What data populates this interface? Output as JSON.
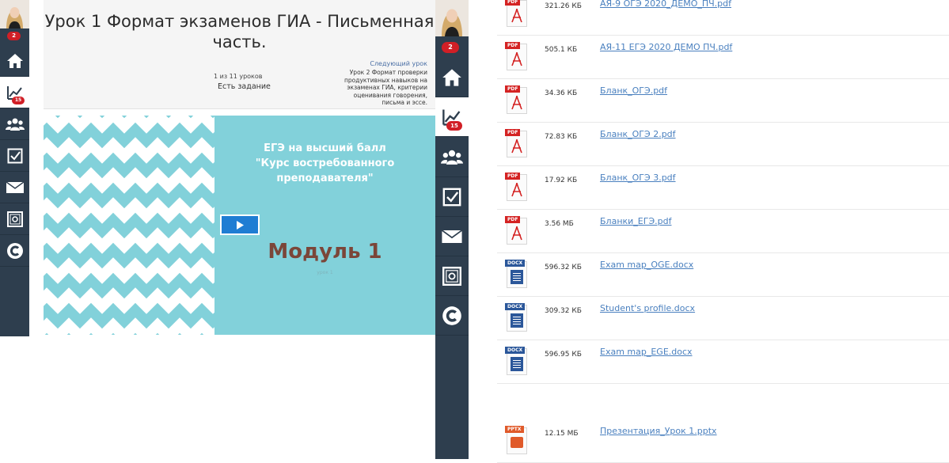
{
  "left_sidebar": {
    "badge": "2",
    "nav_badge": "15",
    "items": [
      "home-icon",
      "statistics-icon",
      "groups-icon",
      "tasks-icon",
      "mail-icon",
      "safe-icon",
      "c-logo-icon"
    ]
  },
  "lesson": {
    "title": "Урок 1 Формат экзаменов ГИА - Письменная часть.",
    "lesson_count": "1 из 11 уроков",
    "task_status": "Есть задание",
    "next_label": "Следующий урок",
    "next_title": "Урок 2 Формат проверки продуктивных навыков на экзаменах ГИА, критерии оценивания говорения, письма и эссе."
  },
  "video": {
    "heading_line1": "ЕГЭ на высший балл",
    "heading_line2": "\"Курс востребованного",
    "heading_line3": "преподавателя\"",
    "module": "Модуль 1",
    "small_text": "урок 1",
    "background_color": "#82d1da"
  },
  "right_sidebar": {
    "badge": "2",
    "nav_badge": "15"
  },
  "files": [
    {
      "type": "PDF",
      "size": "321.26 КБ",
      "name": "АЯ-9 ОГЭ 2020_ДЕМО_ПЧ.pdf"
    },
    {
      "type": "PDF",
      "size": "505.1 КБ",
      "name": "АЯ-11 ЕГЭ 2020 ДЕМО ПЧ.pdf"
    },
    {
      "type": "PDF",
      "size": "34.36 КБ",
      "name": "Бланк_ОГЭ.pdf"
    },
    {
      "type": "PDF",
      "size": "72.83 КБ",
      "name": "Бланк_ОГЭ 2.pdf"
    },
    {
      "type": "PDF",
      "size": "17.92 КБ",
      "name": "Бланк_ОГЭ 3.pdf"
    },
    {
      "type": "PDF",
      "size": "3.56 МБ",
      "name": "Бланки_ЕГЭ.pdf"
    },
    {
      "type": "DOCX",
      "size": "596.32 КБ",
      "name": "Exam map_OGE.docx"
    },
    {
      "type": "DOCX",
      "size": "309.32 КБ",
      "name": "Student's profile.docx"
    },
    {
      "type": "DOCX",
      "size": "596.95 КБ",
      "name": "Exam map_EGE.docx"
    },
    {
      "type": "PPTX",
      "size": "12.15 МБ",
      "name": "Презентация_Урок 1.pptx"
    }
  ],
  "colors": {
    "sidebar": "#2e3e4e",
    "badge": "#d11f26",
    "link": "#4a80bf",
    "play_button": "#1f7dd3",
    "pdf": "#d42323",
    "docx": "#2b579a",
    "pptx": "#e05a2a"
  }
}
